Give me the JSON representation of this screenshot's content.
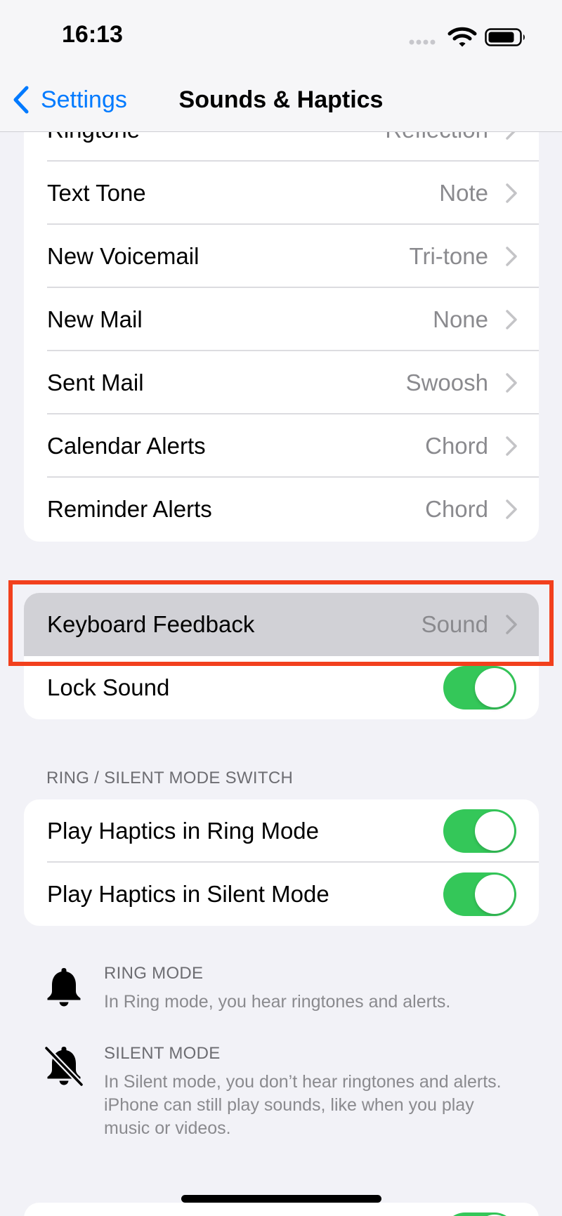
{
  "status_bar": {
    "time": "16:13",
    "icons": [
      "signal-dots-icon",
      "wifi-icon",
      "battery-icon"
    ]
  },
  "nav": {
    "back_label": "Settings",
    "title": "Sounds & Haptics"
  },
  "sounds_list": {
    "items": [
      {
        "label": "Ringtone",
        "value": "Reflection"
      },
      {
        "label": "Text Tone",
        "value": "Note"
      },
      {
        "label": "New Voicemail",
        "value": "Tri-tone"
      },
      {
        "label": "New Mail",
        "value": "None"
      },
      {
        "label": "Sent Mail",
        "value": "Swoosh"
      },
      {
        "label": "Calendar Alerts",
        "value": "Chord"
      },
      {
        "label": "Reminder Alerts",
        "value": "Chord"
      }
    ]
  },
  "feedback_group": {
    "keyboard_feedback": {
      "label": "Keyboard Feedback",
      "value": "Sound"
    },
    "lock_sound": {
      "label": "Lock Sound",
      "on": true
    }
  },
  "ring_silent": {
    "header": "RING / SILENT MODE SWITCH",
    "ring_mode": {
      "label": "Play Haptics in Ring Mode",
      "on": true
    },
    "silent_mode": {
      "label": "Play Haptics in Silent Mode",
      "on": true
    }
  },
  "info": {
    "ring": {
      "title": "RING MODE",
      "text": "In Ring mode, you hear ringtones and alerts."
    },
    "silent": {
      "title": "SILENT MODE",
      "text": "In Silent mode, you don’t hear ringtones and alerts. iPhone can still play sounds, like when you play music or videos."
    }
  },
  "colors": {
    "accent": "#007aff",
    "toggle_on": "#34c759",
    "highlight_border": "#f2401d",
    "row_highlight": "#d1d1d6"
  }
}
